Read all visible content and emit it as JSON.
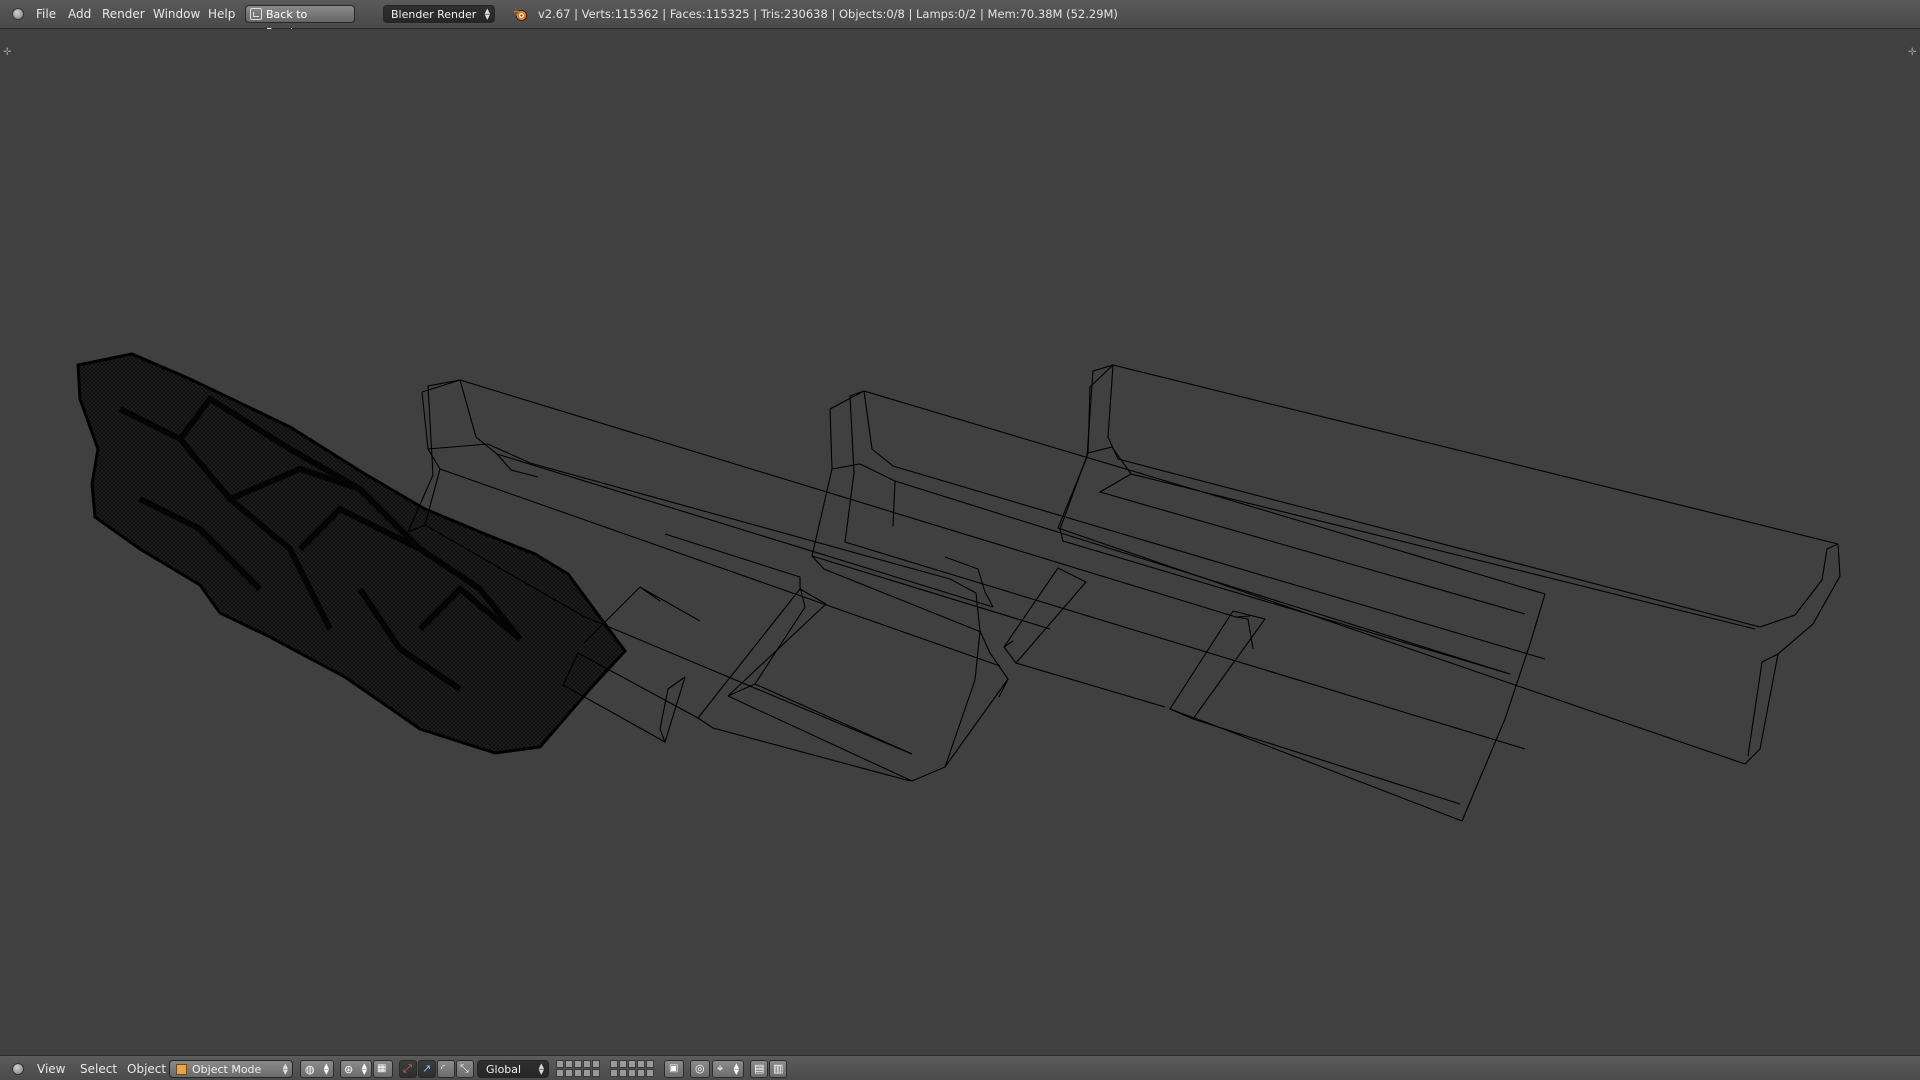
{
  "top_bar": {
    "menu": [
      "File",
      "Add",
      "Render",
      "Window",
      "Help"
    ],
    "back_button": "Back to Previous",
    "render_engine": "Blender Render",
    "stats": "v2.67 | Verts:115362 | Faces:115325 | Tris:230638 | Objects:0/8 | Lamps:0/2 | Mem:70.38M (52.29M)"
  },
  "bottom_bar": {
    "menu": [
      "View",
      "Select",
      "Object"
    ],
    "mode": "Object Mode",
    "orientation": "Global"
  },
  "colors": {
    "viewport_bg": "#404040",
    "header_bg": "#505050",
    "wire": "#000000",
    "mode_icon": "#e8a34b"
  },
  "icons": [
    "editor-type-icon",
    "back-icon",
    "blender-logo-icon",
    "object-mode-cube-icon",
    "viewport-shading-icon",
    "pivot-icon",
    "manipulator-icon",
    "translate-icon",
    "rotate-icon",
    "scale-icon",
    "layer-grid",
    "lock-icon",
    "proportional-edit-icon",
    "snap-icon",
    "opengl-render-icon"
  ]
}
